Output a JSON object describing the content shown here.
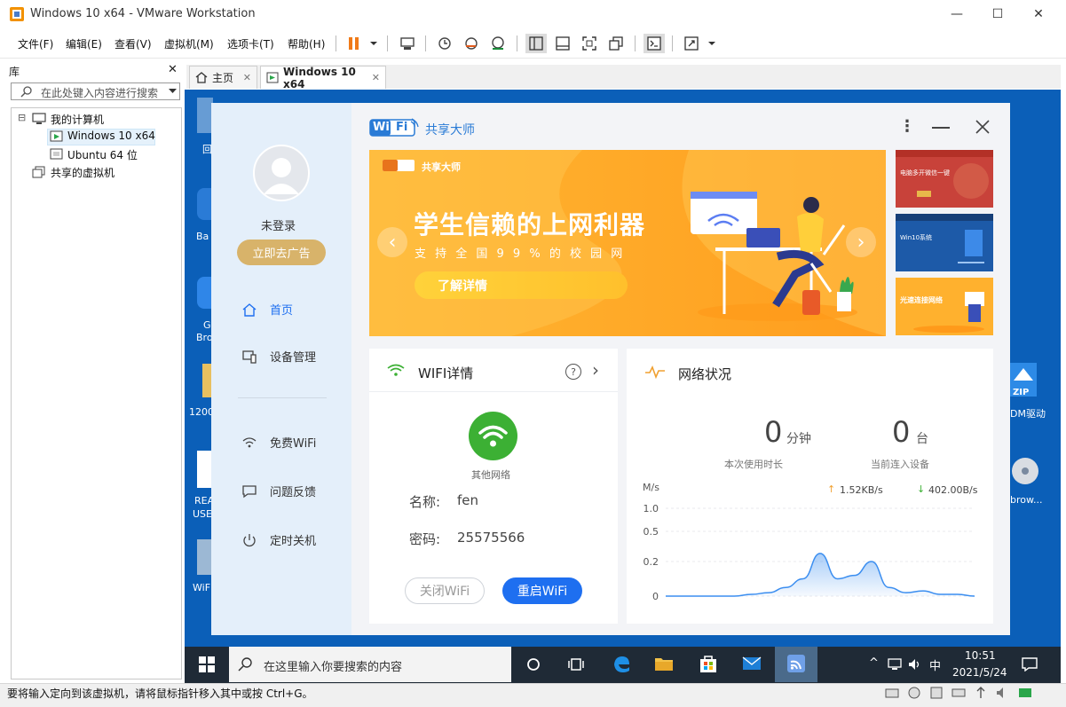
{
  "window": {
    "title": "Windows 10 x64 - VMware Workstation",
    "minimize": "—",
    "maximize": "☐",
    "close": "✕"
  },
  "menu": [
    "文件(F)",
    "编辑(E)",
    "查看(V)",
    "虚拟机(M)",
    "选项卡(T)",
    "帮助(H)"
  ],
  "library": {
    "title": "库",
    "close": "✕",
    "search_placeholder": "在此处键入内容进行搜索",
    "tree": {
      "root": "我的计算机",
      "vm1": "Windows 10 x64",
      "vm2": "Ubuntu 64 位",
      "shared": "共享的虚拟机"
    },
    "collapse": "⊟"
  },
  "tabs": [
    {
      "label": "主页",
      "close": "✕"
    },
    {
      "label": "Windows 10 x64",
      "close": "✕"
    }
  ],
  "desktop": {
    "left_labels": [
      "回",
      "Ba",
      "G",
      "Bro",
      "1200",
      "REA",
      "USE",
      "WiF"
    ],
    "right_labels": [
      "DM驱动",
      "brow..."
    ],
    "zip_label": "ZIP"
  },
  "app": {
    "brand": {
      "wi": "Wi",
      "fi": "Fi",
      "name": "共享大师"
    },
    "menu_dots": "⋮",
    "user": {
      "status": "未登录",
      "ad_button": "立即去广告"
    },
    "sidebar": [
      {
        "label": "首页"
      },
      {
        "label": "设备管理"
      },
      {
        "label": "免费WiFi"
      },
      {
        "label": "问题反馈"
      },
      {
        "label": "定时关机"
      }
    ],
    "banner": {
      "brand": "共享大师",
      "headline": "学生信赖的上网利器",
      "subline": "支 持 全 国 9 9 % 的 校 园 网",
      "cta": "了解详情",
      "prev": "‹",
      "next": "›"
    },
    "thumbs": [
      {
        "caption": "电脑多开微信一键"
      },
      {
        "caption": "Win10系统"
      },
      {
        "caption": "光速连接网络"
      }
    ],
    "wifi_card": {
      "title": "WIFI详情",
      "help": "?",
      "arrow": "›",
      "network_label": "其他网络",
      "name_label": "名称:",
      "name_value": "fen",
      "password_label": "密码:",
      "password_value": "25575566",
      "close_btn": "关闭WiFi",
      "restart_btn": "重启WiFi"
    },
    "network_card": {
      "title": "网络状况",
      "usage_value": "0",
      "usage_unit": "分钟",
      "usage_label": "本次使用时长",
      "devices_value": "0",
      "devices_unit": "台",
      "devices_label": "当前连入设备",
      "unit_label": "M/s",
      "upload": "1.52KB/s",
      "download": "402.00B/s",
      "up_arrow": "↑",
      "down_arrow": "↓",
      "y_ticks": [
        "1.0",
        "0.5",
        "0.2",
        "0"
      ]
    }
  },
  "chart_data": {
    "type": "area",
    "title": "",
    "xlabel": "",
    "ylabel": "M/s",
    "y_ticks": [
      1.0,
      0.5,
      0.2,
      0
    ],
    "series": [
      {
        "values": [
          0,
          0,
          0,
          0,
          0,
          0.01,
          0.02,
          0.05,
          0.1,
          0.28,
          0.1,
          0.12,
          0.2,
          0.05,
          0.02,
          0.03,
          0.01,
          0.01,
          0
        ]
      }
    ],
    "grid": true,
    "line_color": "#3b8ef0"
  },
  "taskbar": {
    "search_placeholder": "在这里输入你要搜索的内容",
    "time": "10:51",
    "date": "2021/5/24",
    "ime": "中",
    "tray_up": "^"
  },
  "status": {
    "text": "要将输入定向到该虚拟机，请将鼠标指针移入其中或按 Ctrl+G。"
  },
  "colors": {
    "accent": "#1e6ff0",
    "banner": "#ffab2e",
    "gold": "#d9b66a",
    "green": "#3cb034"
  }
}
